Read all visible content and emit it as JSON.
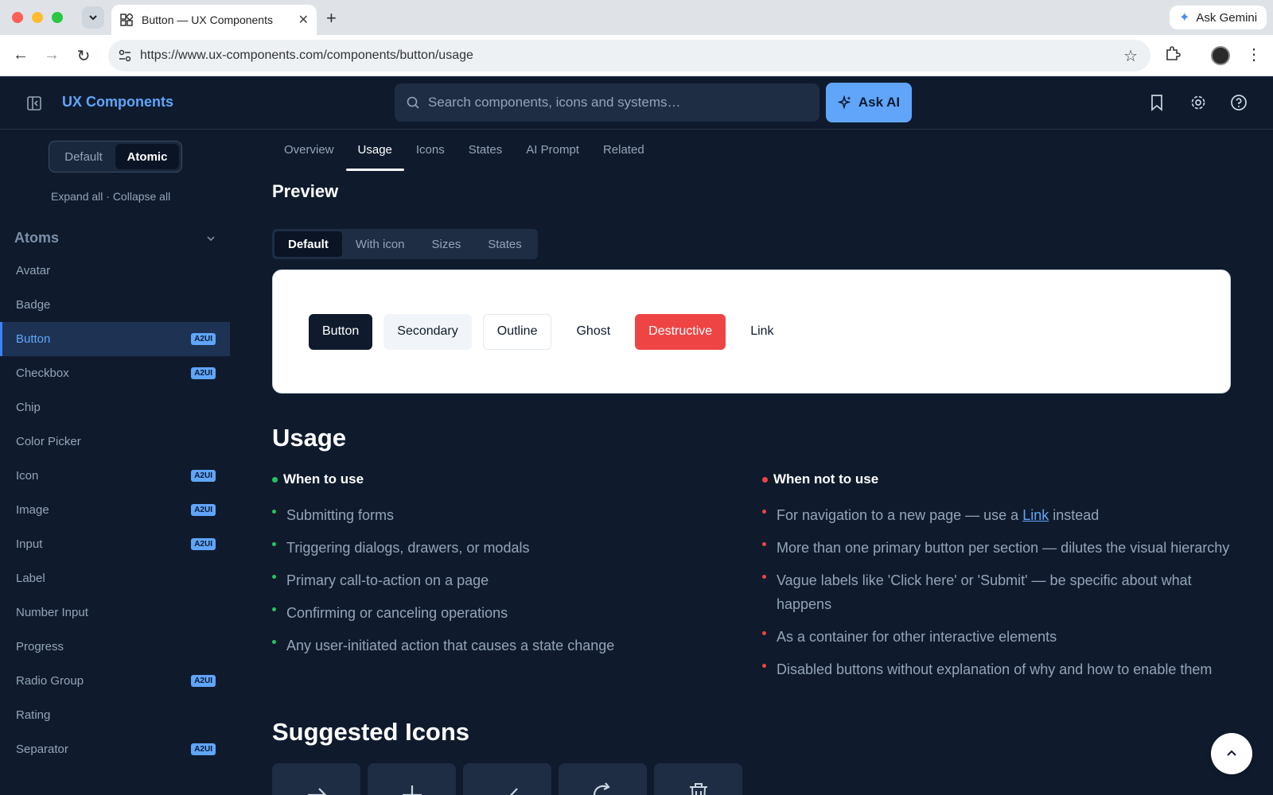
{
  "browser": {
    "tab_title": "Button — UX Components",
    "url": "https://www.ux-components.com/components/button/usage",
    "gemini_label": "Ask Gemini"
  },
  "header": {
    "brand": "UX Components",
    "search_placeholder": "Search components, icons and systems…",
    "ask_ai_label": "Ask AI"
  },
  "sidebar": {
    "mode_default": "Default",
    "mode_atomic": "Atomic",
    "expand_collapse": "Expand all · Collapse all",
    "section_title": "Atoms",
    "items": [
      {
        "label": "Avatar",
        "badge": ""
      },
      {
        "label": "Badge",
        "badge": ""
      },
      {
        "label": "Button",
        "badge": "A2UI"
      },
      {
        "label": "Checkbox",
        "badge": "A2UI"
      },
      {
        "label": "Chip",
        "badge": ""
      },
      {
        "label": "Color Picker",
        "badge": ""
      },
      {
        "label": "Icon",
        "badge": "A2UI"
      },
      {
        "label": "Image",
        "badge": "A2UI"
      },
      {
        "label": "Input",
        "badge": "A2UI"
      },
      {
        "label": "Label",
        "badge": ""
      },
      {
        "label": "Number Input",
        "badge": ""
      },
      {
        "label": "Progress",
        "badge": ""
      },
      {
        "label": "Radio Group",
        "badge": "A2UI"
      },
      {
        "label": "Rating",
        "badge": ""
      },
      {
        "label": "Separator",
        "badge": "A2UI"
      }
    ]
  },
  "main": {
    "tabs": [
      "Overview",
      "Usage",
      "Icons",
      "States",
      "AI Prompt",
      "Related"
    ],
    "preview_title": "Preview",
    "preview_tabs": [
      "Default",
      "With icon",
      "Sizes",
      "States"
    ],
    "preview_buttons": [
      "Button",
      "Secondary",
      "Outline",
      "Ghost",
      "Destructive",
      "Link"
    ],
    "usage_title": "Usage",
    "when_to_use_title": "When to use",
    "when_to_use": [
      "Submitting forms",
      "Triggering dialogs, drawers, or modals",
      "Primary call-to-action on a page",
      "Confirming or canceling operations",
      "Any user-initiated action that causes a state change"
    ],
    "when_not_title": "When not to use",
    "when_not_first_pre": "For navigation to a new page — use a ",
    "when_not_first_link": "Link",
    "when_not_first_post": " instead",
    "when_not": [
      "More than one primary button per section — dilutes the visual hierarchy",
      "Vague labels like 'Click here' or 'Submit' — be specific about what happens",
      "As a container for other interactive elements",
      "Disabled buttons without explanation of why and how to enable them"
    ],
    "suggested_icons_title": "Suggested Icons",
    "suggested_icons": [
      "arrow-right-icon",
      "plus-icon",
      "check-icon",
      "refresh-icon",
      "trash-icon"
    ]
  },
  "colors": {
    "background": "#0f1b2d",
    "accent": "#60a5fa",
    "destructive": "#ef4444",
    "success": "#22c55e"
  }
}
